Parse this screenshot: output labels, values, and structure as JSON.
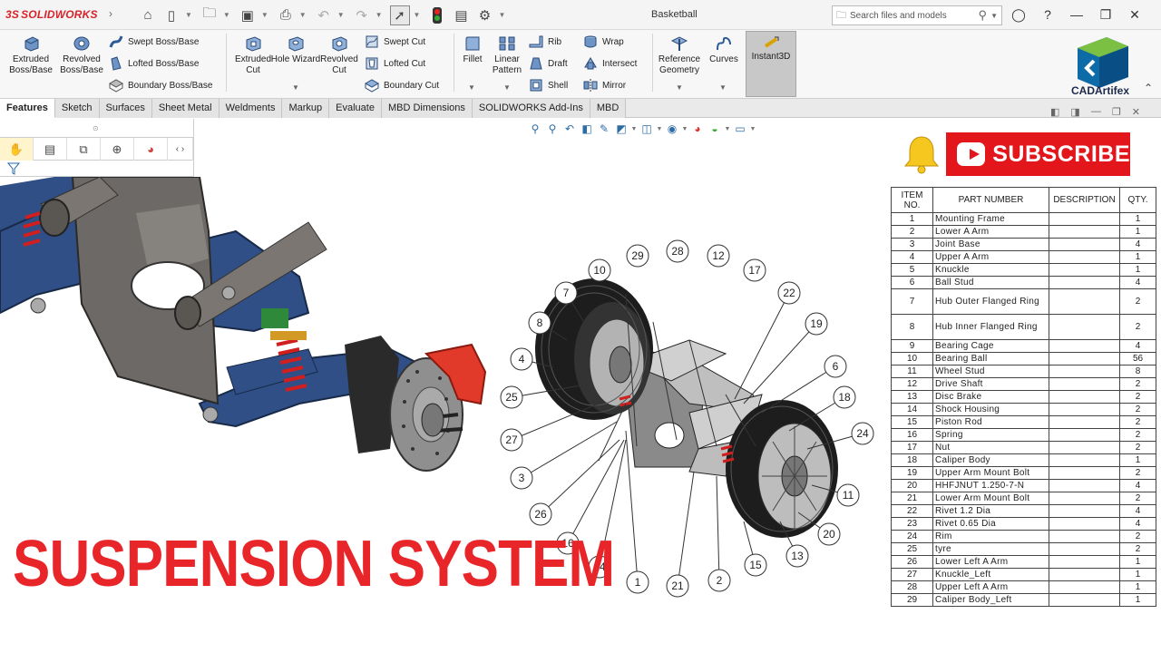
{
  "app": {
    "logo": "SOLIDWORKS",
    "document_title": "Basketball",
    "search_placeholder": "Search files and models"
  },
  "ribbon": {
    "extruded_boss": "Extruded Boss/Base",
    "revolved_boss": "Revolved Boss/Base",
    "swept_boss": "Swept Boss/Base",
    "lofted_boss": "Lofted Boss/Base",
    "boundary_boss": "Boundary Boss/Base",
    "extruded_cut": "Extruded Cut",
    "hole_wizard": "Hole Wizard",
    "revolved_cut": "Revolved Cut",
    "swept_cut": "Swept Cut",
    "lofted_cut": "Lofted Cut",
    "boundary_cut": "Boundary Cut",
    "fillet": "Fillet",
    "linear_pattern": "Linear Pattern",
    "rib": "Rib",
    "draft": "Draft",
    "shell": "Shell",
    "wrap": "Wrap",
    "intersect": "Intersect",
    "mirror": "Mirror",
    "reference_geometry": "Reference Geometry",
    "curves": "Curves",
    "instant3d": "Instant3D",
    "brand": "CADArtifex"
  },
  "tabs": [
    "Features",
    "Sketch",
    "Surfaces",
    "Sheet Metal",
    "Weldments",
    "Markup",
    "Evaluate",
    "MBD Dimensions",
    "SOLIDWORKS Add-Ins",
    "MBD"
  ],
  "overlay": {
    "subscribe": "SUBSCRIBE",
    "headline": "SUSPENSION SYSTEM"
  },
  "balloons": [
    "29",
    "28",
    "12",
    "10",
    "17",
    "7",
    "22",
    "8",
    "19",
    "4",
    "6",
    "18",
    "25",
    "24",
    "27",
    "3",
    "11",
    "26",
    "20",
    "16",
    "13",
    "14",
    "1",
    "15",
    "21",
    "2"
  ],
  "bom": {
    "headers": {
      "item": "ITEM NO.",
      "part": "PART NUMBER",
      "desc": "DESCRIPTION",
      "qty": "QTY."
    },
    "rows": [
      {
        "no": "1",
        "part": "Mounting Frame",
        "qty": "1"
      },
      {
        "no": "2",
        "part": "Lower A Arm",
        "qty": "1"
      },
      {
        "no": "3",
        "part": "Joint Base",
        "qty": "4"
      },
      {
        "no": "4",
        "part": "Upper A Arm",
        "qty": "1"
      },
      {
        "no": "5",
        "part": "Knuckle",
        "qty": "1"
      },
      {
        "no": "6",
        "part": "Ball Stud",
        "qty": "4"
      },
      {
        "no": "7",
        "part": "Hub Outer Flanged Ring",
        "qty": "2"
      },
      {
        "no": "8",
        "part": "Hub Inner Flanged Ring",
        "qty": "2"
      },
      {
        "no": "9",
        "part": "Bearing Cage",
        "qty": "4"
      },
      {
        "no": "10",
        "part": "Bearing Ball",
        "qty": "56"
      },
      {
        "no": "11",
        "part": "Wheel Stud",
        "qty": "8"
      },
      {
        "no": "12",
        "part": "Drive Shaft",
        "qty": "2"
      },
      {
        "no": "13",
        "part": "Disc Brake",
        "qty": "2"
      },
      {
        "no": "14",
        "part": "Shock Housing",
        "qty": "2"
      },
      {
        "no": "15",
        "part": "Piston Rod",
        "qty": "2"
      },
      {
        "no": "16",
        "part": "Spring",
        "qty": "2"
      },
      {
        "no": "17",
        "part": "Nut",
        "qty": "2"
      },
      {
        "no": "18",
        "part": "Caliper Body",
        "qty": "1"
      },
      {
        "no": "19",
        "part": "Upper Arm Mount Bolt",
        "qty": "2"
      },
      {
        "no": "20",
        "part": "HHFJNUT 1.250-7-N",
        "qty": "4"
      },
      {
        "no": "21",
        "part": "Lower Arm Mount Bolt",
        "qty": "2"
      },
      {
        "no": "22",
        "part": "Rivet 1.2 Dia",
        "qty": "4"
      },
      {
        "no": "23",
        "part": "Rivet 0.65 Dia",
        "qty": "4"
      },
      {
        "no": "24",
        "part": "Rim",
        "qty": "2"
      },
      {
        "no": "25",
        "part": "tyre",
        "qty": "2"
      },
      {
        "no": "26",
        "part": "Lower Left A Arm",
        "qty": "1"
      },
      {
        "no": "27",
        "part": "Knuckle_Left",
        "qty": "1"
      },
      {
        "no": "28",
        "part": "Upper Left A Arm",
        "qty": "1"
      },
      {
        "no": "29",
        "part": "Caliper Body_Left",
        "qty": "1"
      }
    ]
  },
  "colors": {
    "accent": "#d6242a",
    "headline": "#e8262a",
    "subscribe_bg": "#e3161b",
    "frame_blue": "#2f4f86"
  }
}
